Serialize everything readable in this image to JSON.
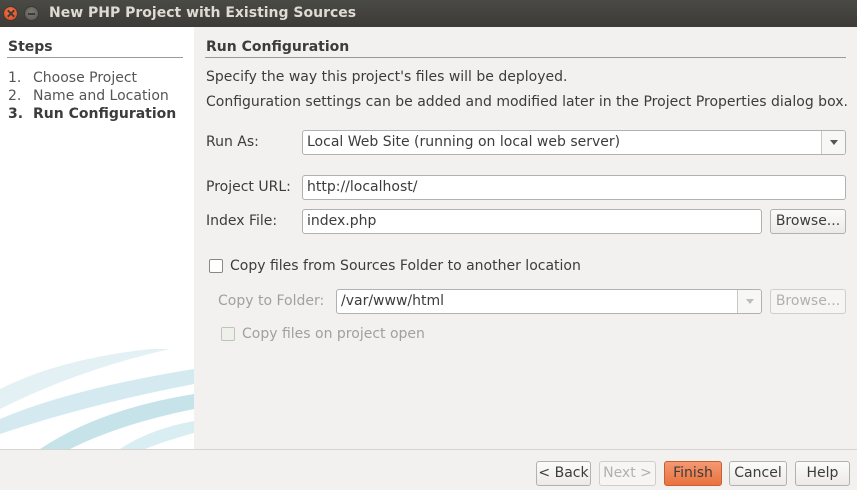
{
  "window": {
    "title": "New PHP Project with Existing Sources"
  },
  "steps": {
    "heading": "Steps",
    "items": [
      {
        "num": "1.",
        "label": "Choose Project"
      },
      {
        "num": "2.",
        "label": "Name and Location"
      },
      {
        "num": "3.",
        "label": "Run Configuration"
      }
    ]
  },
  "main": {
    "title": "Run Configuration",
    "desc1": "Specify the way this project's files will be deployed.",
    "desc2": "Configuration settings can be added and modified later in the Project Properties dialog box.",
    "run_as_label": "Run As:",
    "run_as_value": "Local Web Site (running on local web server)",
    "project_url_label": "Project URL:",
    "project_url_value": "http://localhost/",
    "index_file_label": "Index File:",
    "index_file_value": "index.php",
    "browse_label": "Browse...",
    "copy_files_label": "Copy files from Sources Folder to another location",
    "copy_folder_label": "Copy to Folder:",
    "copy_folder_value": "/var/www/html",
    "copy_browse_label": "Browse...",
    "copy_on_open_label": "Copy files on project open"
  },
  "footer": {
    "back": "< Back",
    "next": "Next >",
    "finish": "Finish",
    "cancel": "Cancel",
    "help": "Help"
  }
}
